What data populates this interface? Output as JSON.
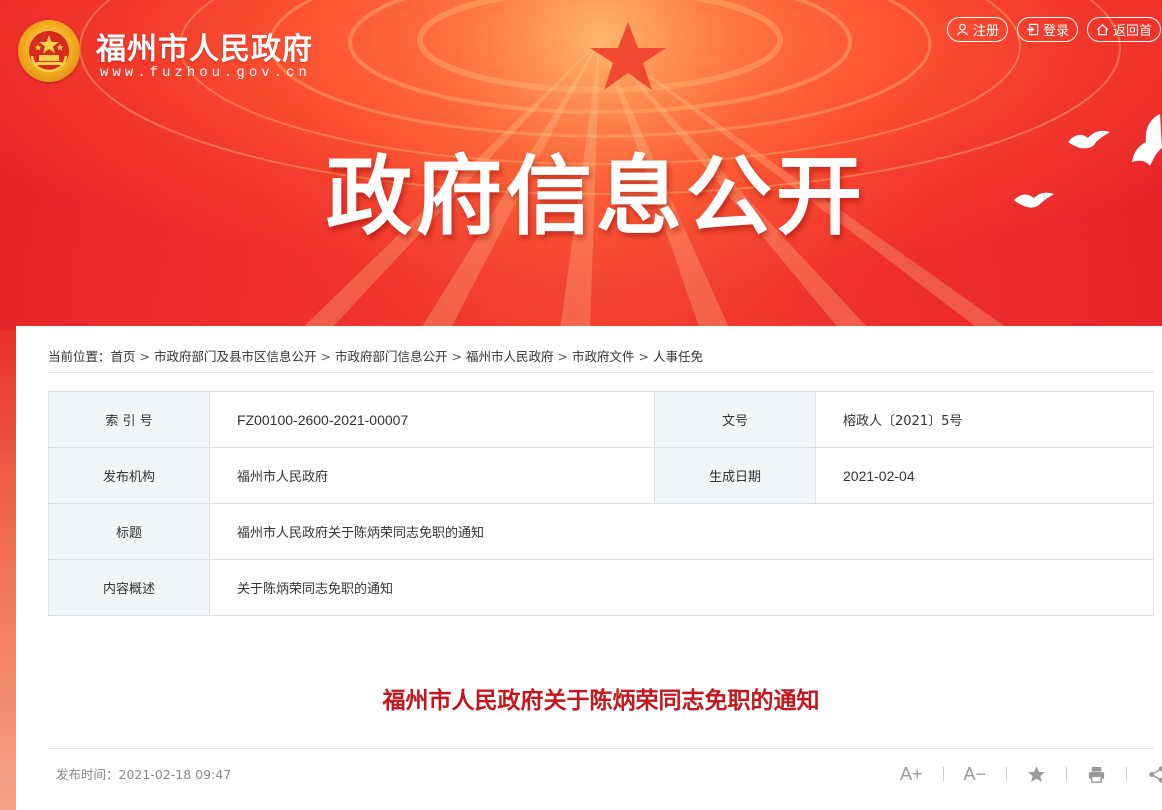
{
  "header": {
    "site_title": "福州市人民政府",
    "site_url": "www.fuzhou.gov.cn",
    "banner_headline": "政府信息公开",
    "links": [
      {
        "label": "注册",
        "icon": "user-icon"
      },
      {
        "label": "登录",
        "icon": "login-icon"
      },
      {
        "label": "返回首",
        "icon": "home-icon"
      }
    ]
  },
  "breadcrumb": {
    "prefix": "当前位置：",
    "items": [
      "首页",
      "市政府部门及县市区信息公开",
      "市政府部门信息公开",
      "福州市人民政府",
      "市政府文件",
      "人事任免"
    ],
    "separator": ">"
  },
  "meta": {
    "index_label": "索 引 号",
    "index_value": "FZ00100-2600-2021-00007",
    "doc_no_label": "文号",
    "doc_no_value": "榕政人〔2021〕5号",
    "issuer_label": "发布机构",
    "issuer_value": "福州市人民政府",
    "date_label": "生成日期",
    "date_value": "2021-02-04",
    "title_label": "标题",
    "title_value": "福州市人民政府关于陈炳荣同志免职的通知",
    "summary_label": "内容概述",
    "summary_value": "关于陈炳荣同志免职的通知"
  },
  "article": {
    "title": "福州市人民政府关于陈炳荣同志免职的通知",
    "publish_time": "发布时间：2021-02-18 09:47"
  },
  "tools": {
    "font_increase": "A+",
    "font_decrease": "A−",
    "icons": [
      "star-icon",
      "print-icon",
      "share-icon"
    ]
  },
  "colors": {
    "banner_red": "#e8262a",
    "title_red": "#c4161c",
    "label_bg": "#f3f4f6"
  }
}
